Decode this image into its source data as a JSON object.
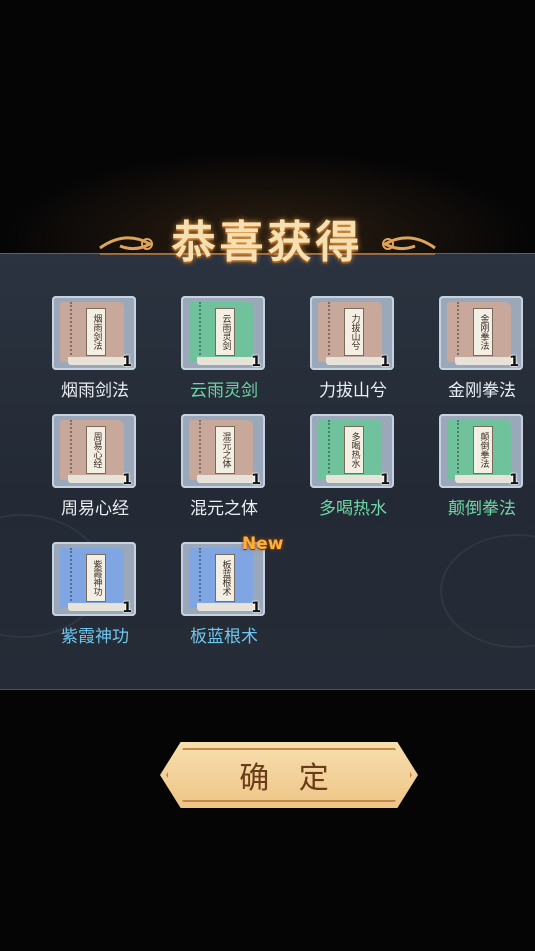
{
  "title": "恭喜获得",
  "new_badge": "New",
  "confirm_label": "确 定",
  "items": [
    {
      "name": "烟雨剑法",
      "slip": "烟雨剑法",
      "count": "1",
      "book": "tan"
    },
    {
      "name": "云雨灵剑",
      "slip": "云雨灵剑",
      "count": "1",
      "book": "green"
    },
    {
      "name": "力拔山兮",
      "slip": "力拔山兮",
      "count": "1",
      "book": "tan"
    },
    {
      "name": "金刚拳法",
      "slip": "金刚拳法",
      "count": "1",
      "book": "tan"
    },
    {
      "name": "周易心经",
      "slip": "周易心经",
      "count": "1",
      "book": "tan"
    },
    {
      "name": "混元之体",
      "slip": "混元之体",
      "count": "1",
      "book": "tan"
    },
    {
      "name": "多喝热水",
      "slip": "多喝热水",
      "count": "1",
      "book": "green"
    },
    {
      "name": "颠倒拳法",
      "slip": "颠倒拳法",
      "count": "1",
      "book": "green"
    },
    {
      "name": "紫霞神功",
      "slip": "紫霞神功",
      "count": "1",
      "book": "blue"
    },
    {
      "name": "板蓝根术",
      "slip": "板蓝根术",
      "count": "1",
      "book": "blue"
    }
  ],
  "colors": {
    "tan": "#c8a89a",
    "green": "#6fc29b",
    "blue": "#7fa6e3",
    "title": "#f6dfb0"
  }
}
